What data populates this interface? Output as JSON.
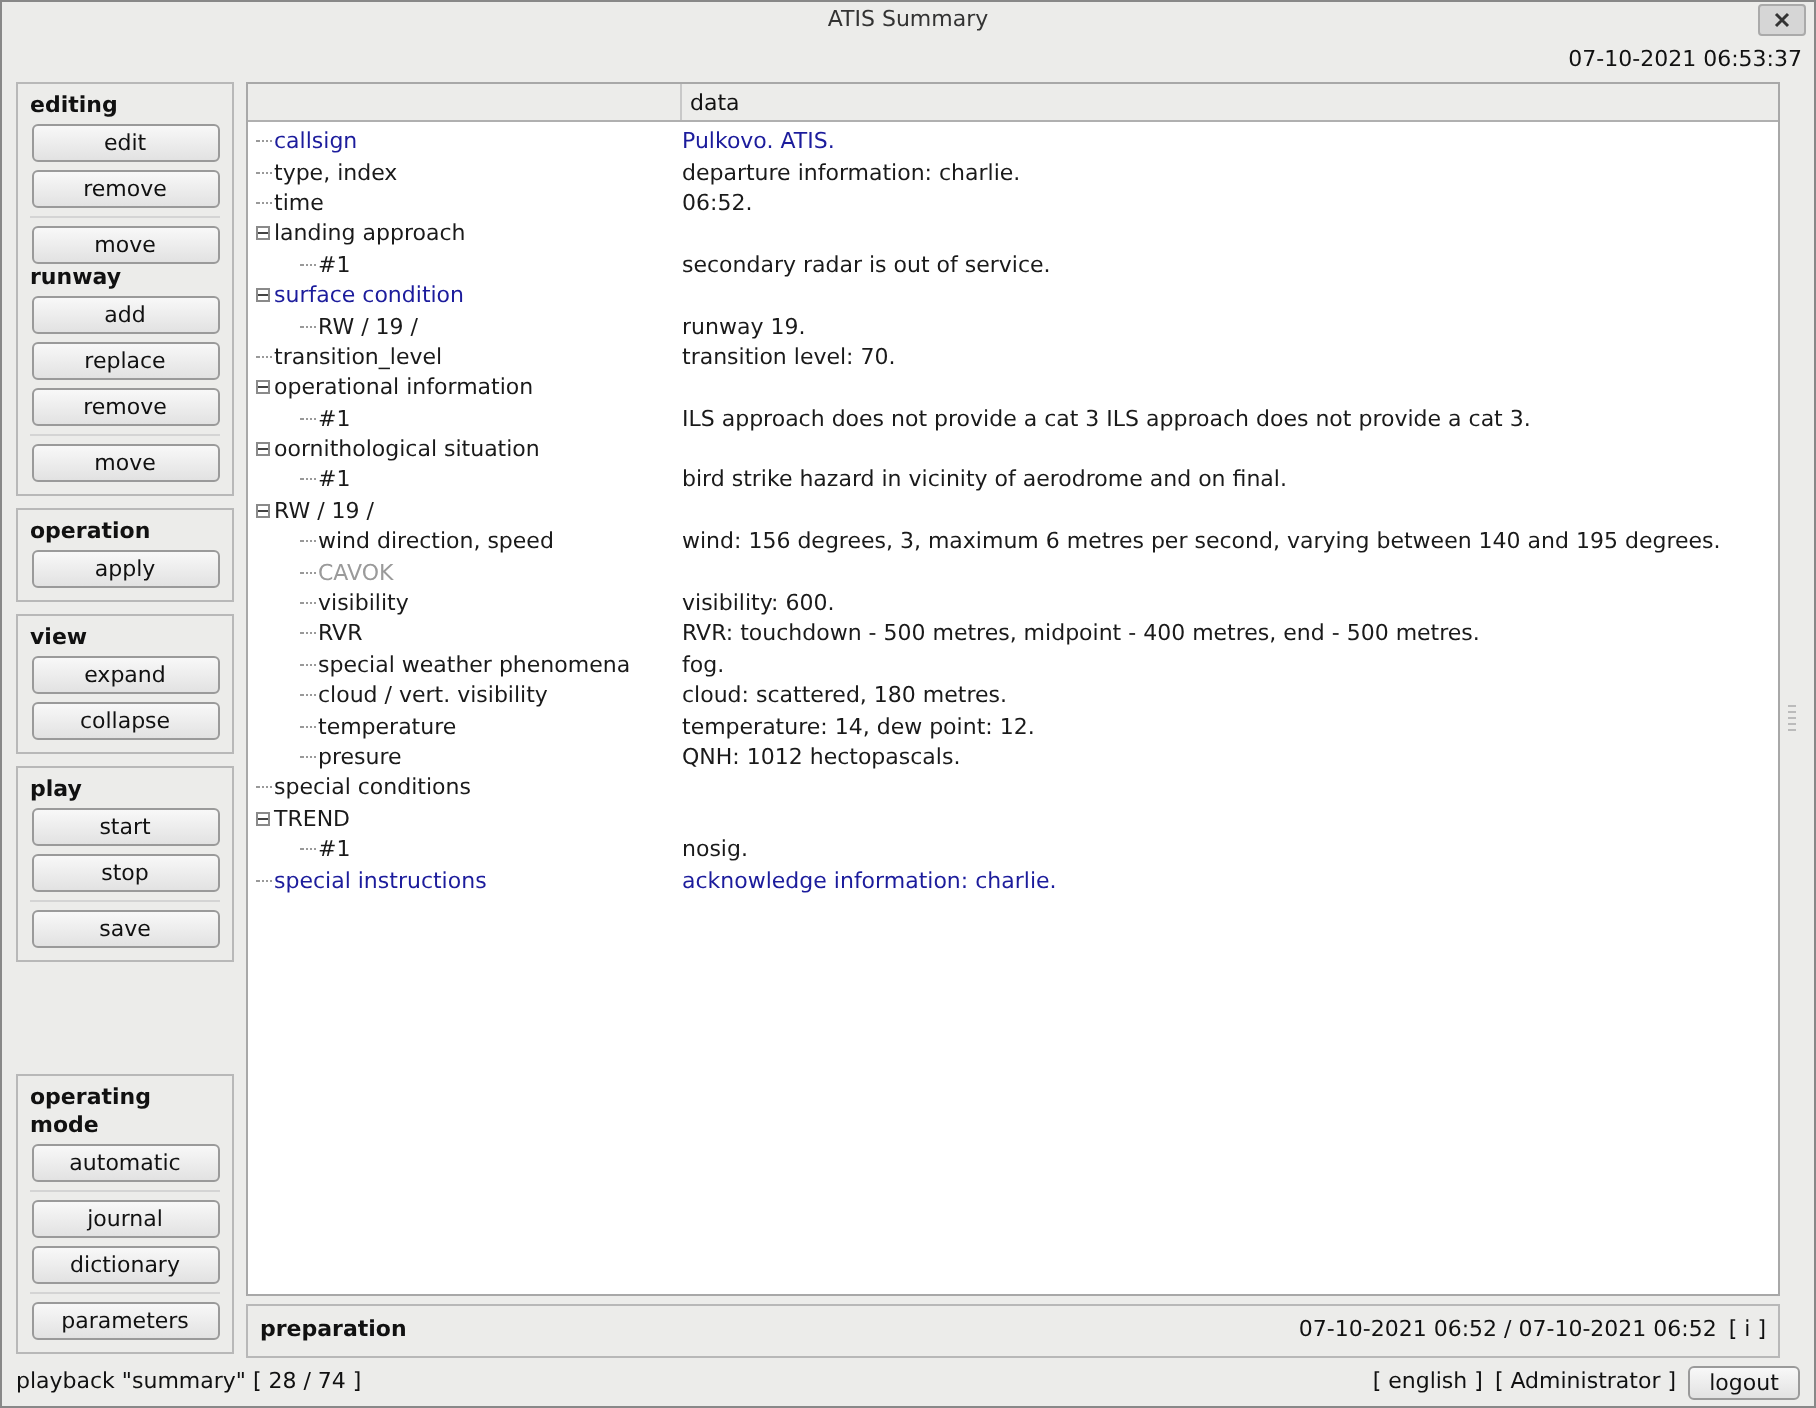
{
  "window": {
    "title": "ATIS Summary"
  },
  "clock": "07-10-2021 06:53:37",
  "sidebar": {
    "panels": [
      {
        "sections": [
          {
            "title": "editing",
            "button_groups": [
              [
                "edit",
                "remove"
              ],
              [
                "move"
              ]
            ]
          },
          {
            "title": "runway",
            "button_groups": [
              [
                "add",
                "replace",
                "remove"
              ],
              [
                "move"
              ]
            ]
          }
        ]
      },
      {
        "sections": [
          {
            "title": "operation",
            "button_groups": [
              [
                "apply"
              ]
            ]
          }
        ]
      },
      {
        "sections": [
          {
            "title": "view",
            "button_groups": [
              [
                "expand",
                "collapse"
              ]
            ]
          }
        ]
      },
      {
        "sections": [
          {
            "title": "play",
            "button_groups": [
              [
                "start",
                "stop"
              ],
              [
                "save"
              ]
            ]
          }
        ]
      }
    ],
    "bottom_panel": {
      "sections": [
        {
          "title": "operating mode",
          "button_groups": [
            [
              "automatic"
            ],
            [
              "journal",
              "dictionary"
            ],
            [
              "parameters"
            ]
          ]
        }
      ]
    }
  },
  "tree": {
    "columns": [
      "data"
    ],
    "items": [
      {
        "label": "callsign",
        "value": "Pulkovo. ATIS.",
        "color": "#1c1c9c"
      },
      {
        "label": "type, index",
        "value": "departure information: charlie.",
        "color": "#1a1a1a"
      },
      {
        "label": "time",
        "value": "06:52.",
        "color": "#1a1a1a"
      },
      {
        "label": "landing approach",
        "color": "#1a1a1a",
        "expanded": true,
        "children": [
          {
            "label": "#1",
            "value": "secondary radar is out of service.",
            "color": "#1a1a1a"
          }
        ]
      },
      {
        "label": "surface condition",
        "color": "#1c1c9c",
        "expanded": true,
        "children": [
          {
            "label": "RW / 19 /",
            "value": "runway 19.",
            "color": "#1a1a1a"
          }
        ]
      },
      {
        "label": "transition_level",
        "value": "transition level: 70.",
        "color": "#1a1a1a"
      },
      {
        "label": "operational information",
        "color": "#1a1a1a",
        "expanded": true,
        "children": [
          {
            "label": "#1",
            "value": "ILS approach does not provide a cat 3 ILS approach does not provide a cat 3.",
            "color": "#1a1a1a"
          }
        ]
      },
      {
        "label": "oornithological situation",
        "color": "#1a1a1a",
        "expanded": true,
        "children": [
          {
            "label": "#1",
            "value": "bird strike hazard in vicinity of aerodrome and on final.",
            "color": "#1a1a1a"
          }
        ]
      },
      {
        "label": "RW / 19 /",
        "color": "#1a1a1a",
        "expanded": true,
        "children": [
          {
            "label": "wind direction, speed",
            "value": "wind: 156 degrees, 3, maximum 6 metres per second, varying between 140 and 195 degrees.",
            "color": "#1a1a1a"
          },
          {
            "label": "CAVOK",
            "color": "#9a9a9a"
          },
          {
            "label": "visibility",
            "value": "visibility: 600.",
            "color": "#1a1a1a"
          },
          {
            "label": "RVR",
            "value": "RVR: touchdown - 500 metres, midpoint - 400 metres, end - 500 metres.",
            "color": "#1a1a1a"
          },
          {
            "label": "special weather phenomena",
            "value": "fog.",
            "color": "#1a1a1a"
          },
          {
            "label": "cloud / vert. visibility",
            "value": "cloud: scattered, 180 metres.",
            "color": "#1a1a1a"
          },
          {
            "label": "temperature",
            "value": "temperature: 14, dew point: 12.",
            "color": "#1a1a1a"
          },
          {
            "label": "presure",
            "value": "QNH: 1012 hectopascals.",
            "color": "#1a1a1a"
          }
        ]
      },
      {
        "label": "special conditions",
        "color": "#1a1a1a"
      },
      {
        "label": "TREND",
        "color": "#1a1a1a",
        "expanded": true,
        "children": [
          {
            "label": "#1",
            "value": "nosig.",
            "color": "#1a1a1a"
          }
        ]
      },
      {
        "label": "special instructions",
        "value": "acknowledge information: charlie.",
        "color": "#1c1c9c"
      }
    ]
  },
  "status_panel": {
    "state": "preparation",
    "period": "07-10-2021 06:52 / 07-10-2021 06:52",
    "info_button": "[ i ]"
  },
  "status_bar": {
    "playback": "playback \"summary\" [ 28 / 74 ]",
    "language": "[ english ]",
    "user": "[ Administrator ]",
    "logout": "logout"
  }
}
